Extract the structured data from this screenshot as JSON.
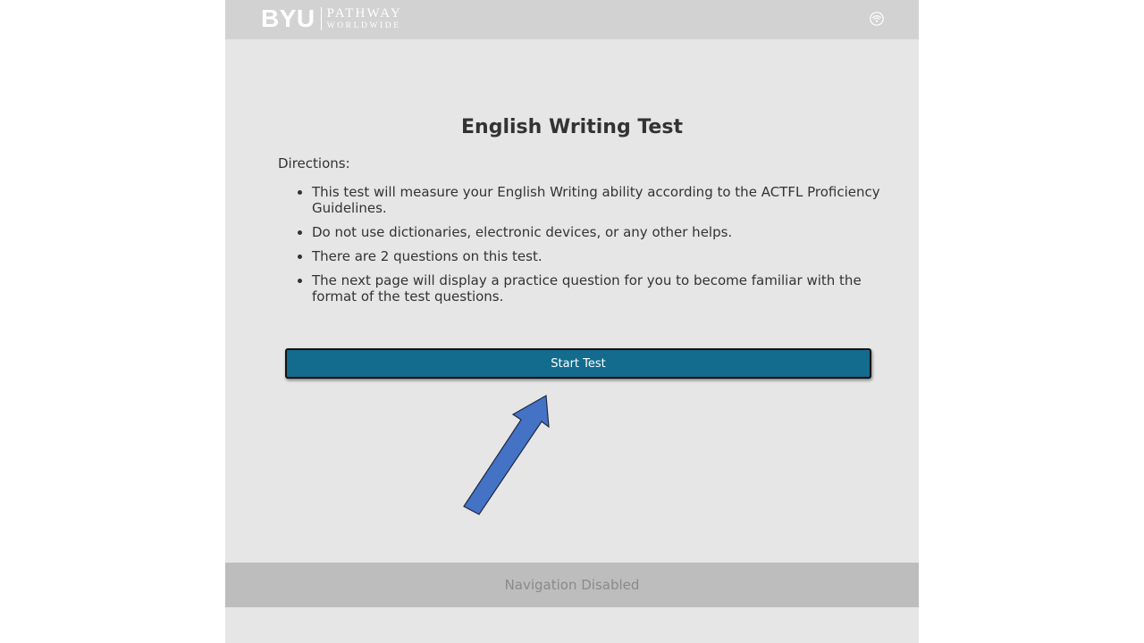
{
  "header": {
    "logo": {
      "primary": "BYU",
      "line1": "PATHWAY",
      "line2": "WORLDWIDE"
    },
    "status_icon": "wifi-icon"
  },
  "main": {
    "title": "English Writing Test",
    "directions_label": "Directions:",
    "directions": [
      "This test will measure your English Writing ability according to the ACTFL Proficiency Guidelines.",
      "Do not use dictionaries, electronic devices, or any other helps.",
      "There are 2 questions on this test.",
      "The next page will display a practice question for you to become familiar with the format of the test questions."
    ],
    "start_button_label": "Start Test"
  },
  "annotation": {
    "icon": "arrow-up-right-icon"
  },
  "footer": {
    "text": "Navigation Disabled"
  },
  "colors": {
    "page_background": "#e6e6e6",
    "header_background": "#d2d2d2",
    "button": "#136b8e",
    "arrow": "#4472c4",
    "footer_background": "#bdbdbd"
  }
}
